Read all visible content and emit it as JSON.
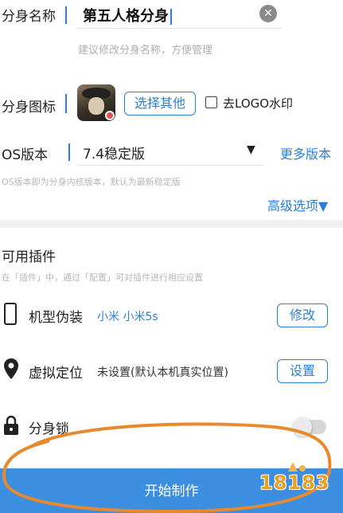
{
  "name_section": {
    "label": "分身名称",
    "value": "第五人格分身",
    "hint": "建议修改分身名称，方便管理"
  },
  "icon_section": {
    "label": "分身图标",
    "choose_button": "选择其他",
    "remove_logo_label": "去LOGO水印",
    "remove_logo_checked": false
  },
  "os_section": {
    "label": "OS版本",
    "value": "7.4稳定版",
    "more_versions": "更多版本",
    "hint": "OS版本即为分身内核版本，默认为最新稳定版",
    "advanced_options": "高级选项▼"
  },
  "plugins": {
    "title": "可用插件",
    "hint": "在「插件」中，通过「配置」可对插件进行相应设置",
    "items": [
      {
        "icon": "phone-icon",
        "name": "机型伪装",
        "value": "小米 小米5s",
        "button": "修改"
      },
      {
        "icon": "location-pin-icon",
        "name": "虚拟定位",
        "value": "未设置(默认本机真实位置)",
        "button": "设置"
      },
      {
        "icon": "lock-icon",
        "name": "分身锁",
        "toggle_on": false
      }
    ]
  },
  "start_button": "开始制作",
  "watermark": "18183",
  "colors": {
    "accent": "#2b7fd6",
    "primary_button": "#3c8fe0",
    "annotation": "#e8892c"
  }
}
